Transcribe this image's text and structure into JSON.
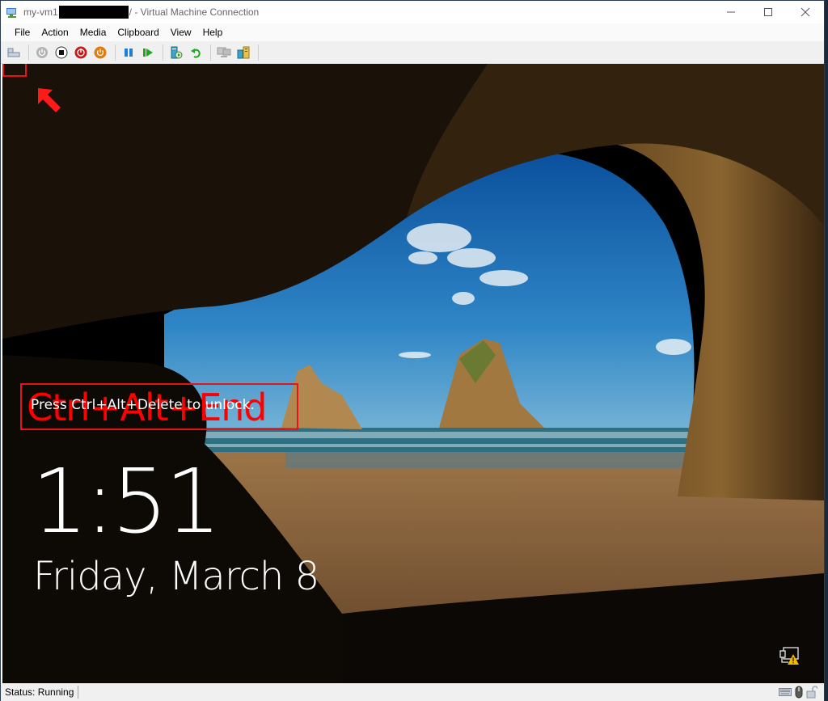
{
  "window": {
    "title_prefix": "my-vm1",
    "title_suffix": "/ - Virtual Machine Connection",
    "controls": {
      "minimize": "—",
      "maximize": "☐",
      "close": "✕"
    }
  },
  "menu": {
    "items": [
      {
        "label": "File"
      },
      {
        "label": "Action"
      },
      {
        "label": "Media"
      },
      {
        "label": "Clipboard"
      },
      {
        "label": "View"
      },
      {
        "label": "Help"
      }
    ]
  },
  "toolbar": {
    "buttons": [
      {
        "name": "ctrl-alt-del-icon",
        "title": "Ctrl+Alt+Delete"
      },
      {
        "name": "start-icon",
        "title": "Start"
      },
      {
        "name": "turn-off-icon",
        "title": "Turn Off"
      },
      {
        "name": "shut-down-icon",
        "title": "Shut Down"
      },
      {
        "name": "save-icon",
        "title": "Save"
      },
      {
        "name": "pause-icon",
        "title": "Pause"
      },
      {
        "name": "resume-icon",
        "title": "Reset"
      },
      {
        "name": "checkpoint-icon",
        "title": "Checkpoint"
      },
      {
        "name": "revert-icon",
        "title": "Revert"
      },
      {
        "name": "enhanced-session-icon",
        "title": "Enhanced Session"
      },
      {
        "name": "share-icon",
        "title": "Share"
      }
    ]
  },
  "screen": {
    "annotation_text": "Ctrl+Alt+End",
    "unlock_message": "Press Ctrl+Alt+Delete to unlock.",
    "time": "1:51",
    "date": "Friday, March 8"
  },
  "colors": {
    "annotation": "#ff0000",
    "pause": "#1e7fd8",
    "play": "#1fa61f",
    "turn_off": "#c91a1a",
    "save": "#e07c0e"
  },
  "status": {
    "text": "Status: Running"
  }
}
